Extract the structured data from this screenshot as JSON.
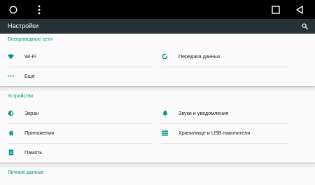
{
  "appbar": {
    "title": "Настройки"
  },
  "sections": [
    {
      "header": "Беспроводные сети",
      "items": [
        {
          "label": "Wi-Fi",
          "icon": "wifi-icon"
        },
        {
          "label": "Передача данных",
          "icon": "data-usage-icon"
        },
        {
          "label": "Ещё",
          "icon": "more-dots-icon"
        }
      ]
    },
    {
      "header": "Устройство",
      "items": [
        {
          "label": "Экран",
          "icon": "brightness-icon"
        },
        {
          "label": "Звуки и уведомления",
          "icon": "bell-icon"
        },
        {
          "label": "Приложения",
          "icon": "android-icon"
        },
        {
          "label": "Хранилище и USB-накопители",
          "icon": "storage-icon"
        },
        {
          "label": "Память",
          "icon": "memory-icon"
        }
      ]
    },
    {
      "header": "Личные данные"
    }
  ],
  "colors": {
    "accent": "#009688",
    "appbar": "#263238",
    "navbar": "#000000",
    "background": "#eeeeee",
    "card": "#fafafa"
  }
}
